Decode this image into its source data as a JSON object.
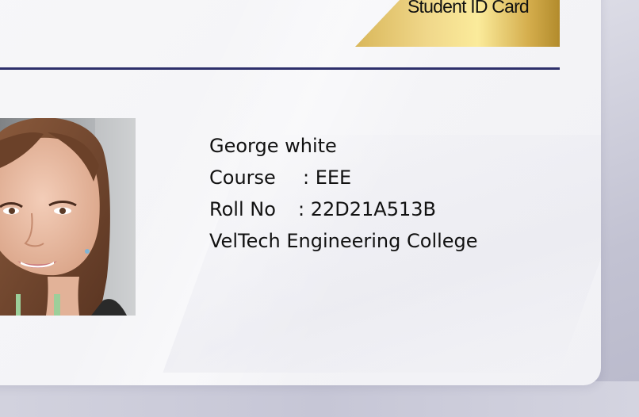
{
  "card": {
    "title": "Student ID Card",
    "student": {
      "name": "George white",
      "course_label": "Course",
      "course_value": ": EEE",
      "roll_label": "Roll No",
      "roll_value": ": 22D21A513B",
      "college": "VelTech Engineering College"
    },
    "photo": {
      "icon": "student-portrait"
    }
  },
  "colors": {
    "divider": "#2d2f6b",
    "banner_gold_light": "#fbeb9b",
    "banner_gold_dark": "#b28b2c",
    "card_background": "#f5f5f8",
    "page_background": "#d3d3df"
  }
}
